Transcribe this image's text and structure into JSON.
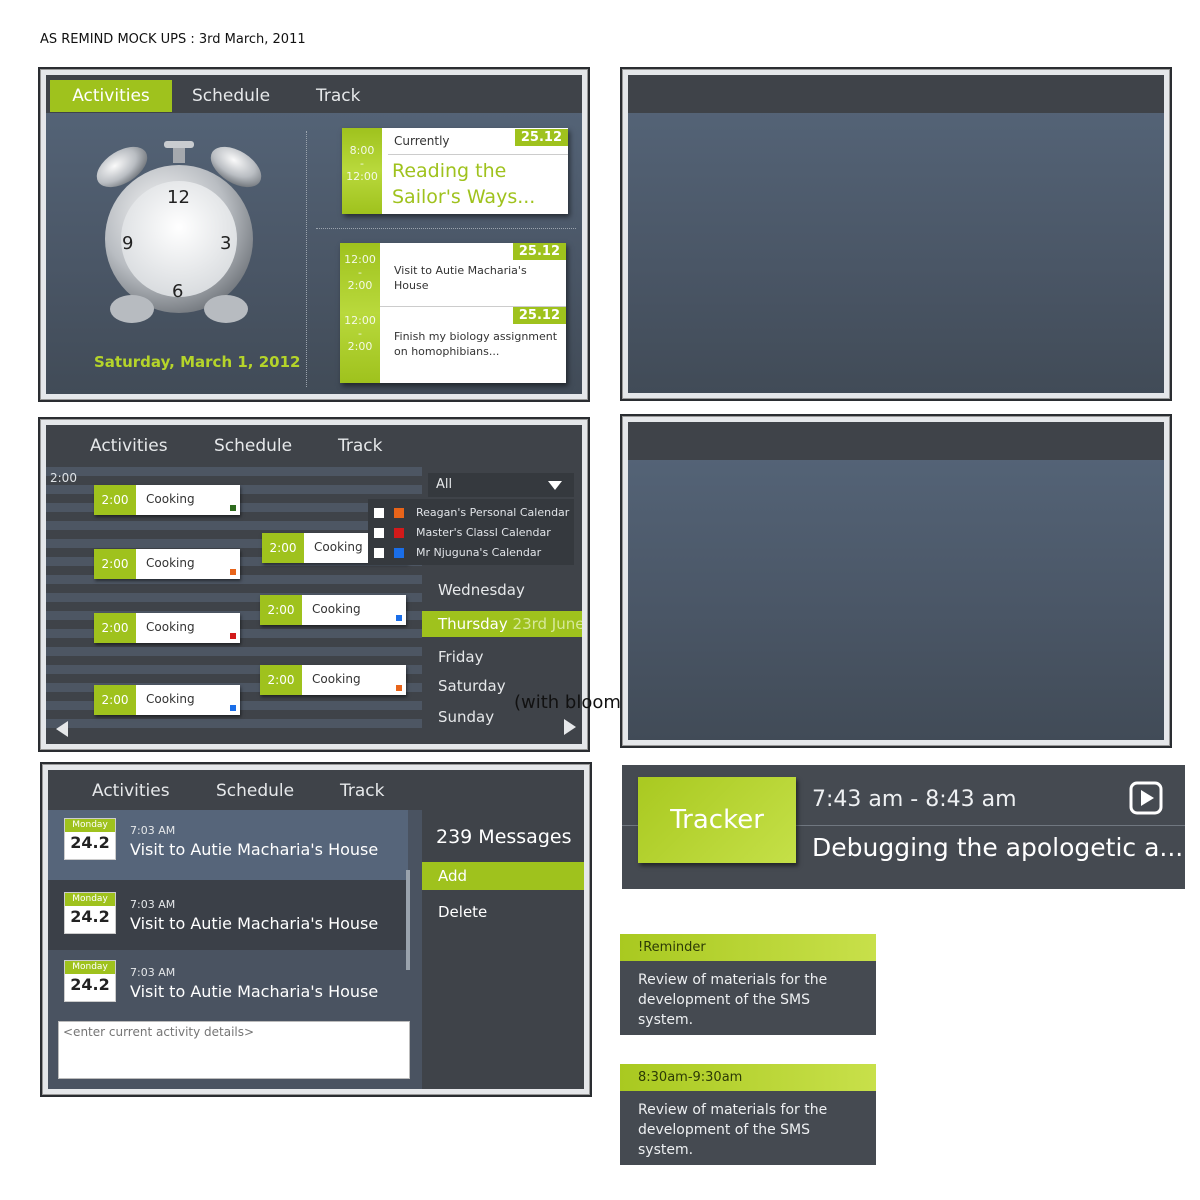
{
  "page": {
    "title": "AS REMIND MOCK UPS : 3rd March, 2011"
  },
  "colors": {
    "accent": "#9fc21d",
    "panel": "#3f4349",
    "screen": "#4d5868"
  },
  "tabs": [
    "Activities",
    "Schedule",
    "Track"
  ],
  "screen1": {
    "clock_numbers": {
      "n12": "12",
      "n3": "3",
      "n6": "6",
      "n9": "9"
    },
    "date": "Saturday, March 1, 2012",
    "current": {
      "start": "8:00",
      "sep": "-",
      "end": "12:00",
      "label": "Currently",
      "badge": "25.12",
      "title": "Reading the Sailor's Ways..."
    },
    "upcoming": [
      {
        "start": "12:00",
        "sep": "-",
        "end": "2:00",
        "badge": "25.12",
        "text": "Visit to Autie Macharia's House"
      },
      {
        "start": "12:00",
        "sep": "-",
        "end": "2:00",
        "badge": "25.12",
        "text": "Finish my biology assignment on homophibians..."
      }
    ]
  },
  "screen2": {
    "time_label": "2:00",
    "events": [
      {
        "time": "2:00",
        "name": "Cooking",
        "dot": "#2e6b1e"
      },
      {
        "time": "2:00",
        "name": "Cooking",
        "dot": "#e8641a"
      },
      {
        "time": "2:00",
        "name": "Cooking",
        "dot": "#d21a1a"
      },
      {
        "time": "2:00",
        "name": "Cooking",
        "dot": "#1a6ee8"
      },
      {
        "time": "2:00",
        "name": "Cooking",
        "dot": "#e8641a"
      },
      {
        "time": "2:00",
        "name": "Cooking",
        "dot": "#1a6ee8"
      },
      {
        "time": "2:00",
        "name": "Cooking",
        "dot": "#e8641a"
      }
    ],
    "filter": {
      "selected": "All",
      "options": [
        {
          "label": "Reagan's Personal Calendar",
          "color": "#e8641a"
        },
        {
          "label": "Master's Classl Calendar",
          "color": "#d21a1a"
        },
        {
          "label": "Mr Njuguna's Calendar",
          "color": "#1a6ee8"
        }
      ]
    },
    "days": [
      "Wednesday",
      "Friday",
      "Saturday",
      "Sunday"
    ],
    "selected_day": {
      "name": "Thursday",
      "date": "23rd June"
    },
    "note": "(with bloom effect)"
  },
  "screen3": {
    "messages": [
      {
        "month": "Monday",
        "day": "24.2",
        "time": "7:03 AM",
        "title": "Visit to Autie Macharia's House"
      },
      {
        "month": "Monday",
        "day": "24.2",
        "time": "7:03 AM",
        "title": "Visit to Autie Macharia's House"
      },
      {
        "month": "Monday",
        "day": "24.2",
        "time": "7:03 AM",
        "title": "Visit to Autie Macharia's House"
      }
    ],
    "input_placeholder": "<enter current activity details>",
    "count": "239 Messages",
    "actions": [
      "Add",
      "Delete"
    ]
  },
  "tracker": {
    "label": "Tracker",
    "time": "7:43 am - 8:43 am",
    "title": "Debugging the apologetic a..."
  },
  "reminders": [
    {
      "header": "!Reminder",
      "body": "Review of materials for the development of the SMS system."
    },
    {
      "header": "8:30am-9:30am",
      "body": "Review of materials for the development of the SMS system."
    }
  ]
}
